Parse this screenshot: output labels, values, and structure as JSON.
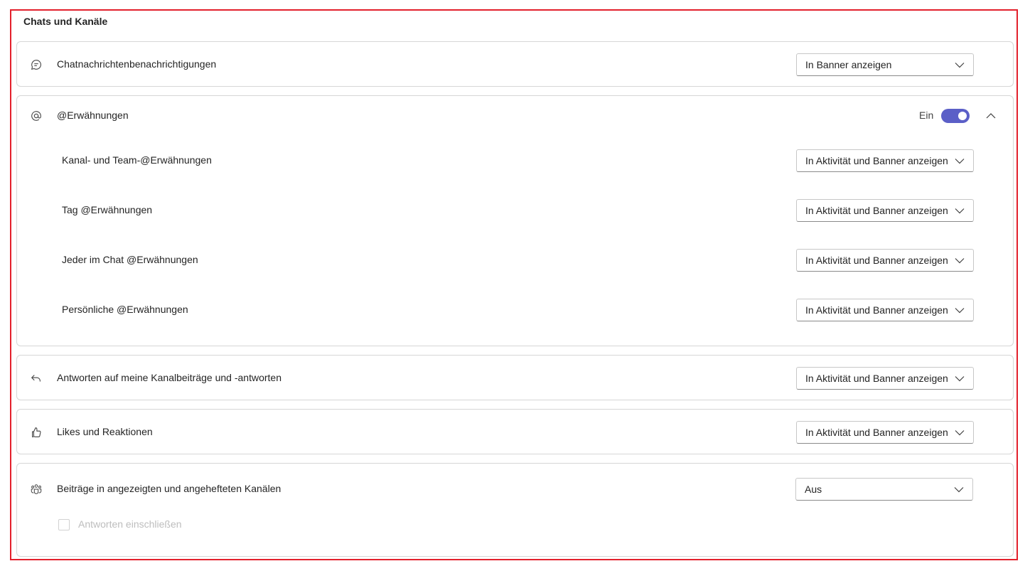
{
  "section_title": "Chats und Kanäle",
  "chat_messages": {
    "label": "Chatnachrichtenbenachrichtigungen",
    "icon": "chat-bubble-icon",
    "dropdown_value": "In Banner anzeigen"
  },
  "mentions": {
    "label": "@Erwähnungen",
    "icon": "at-sign-icon",
    "toggle_label": "Ein",
    "toggle_on": true,
    "expanded": true,
    "items": [
      {
        "label": "Kanal- und Team-@Erwähnungen",
        "dropdown_value": "In Aktivität und Banner anzeigen"
      },
      {
        "label": "Tag @Erwähnungen",
        "dropdown_value": "In Aktivität und Banner anzeigen"
      },
      {
        "label": "Jeder im Chat @Erwähnungen",
        "dropdown_value": "In Aktivität und Banner anzeigen"
      },
      {
        "label": "Persönliche @Erwähnungen",
        "dropdown_value": "In Aktivität und Banner anzeigen"
      }
    ]
  },
  "replies": {
    "label": "Antworten auf meine Kanalbeiträge und -antworten",
    "icon": "reply-arrow-icon",
    "dropdown_value": "In Aktivität und Banner anzeigen"
  },
  "likes": {
    "label": "Likes und Reaktionen",
    "icon": "thumbs-up-icon",
    "dropdown_value": "In Aktivität und Banner anzeigen"
  },
  "channel_posts": {
    "label": "Beiträge in angezeigten und angehefteten Kanälen",
    "icon": "people-team-icon",
    "dropdown_value": "Aus",
    "checkbox_label": "Antworten einschließen",
    "checkbox_checked": false,
    "checkbox_disabled": true
  },
  "colors": {
    "accent": "#5b5fc7",
    "frame": "#e3202c"
  }
}
